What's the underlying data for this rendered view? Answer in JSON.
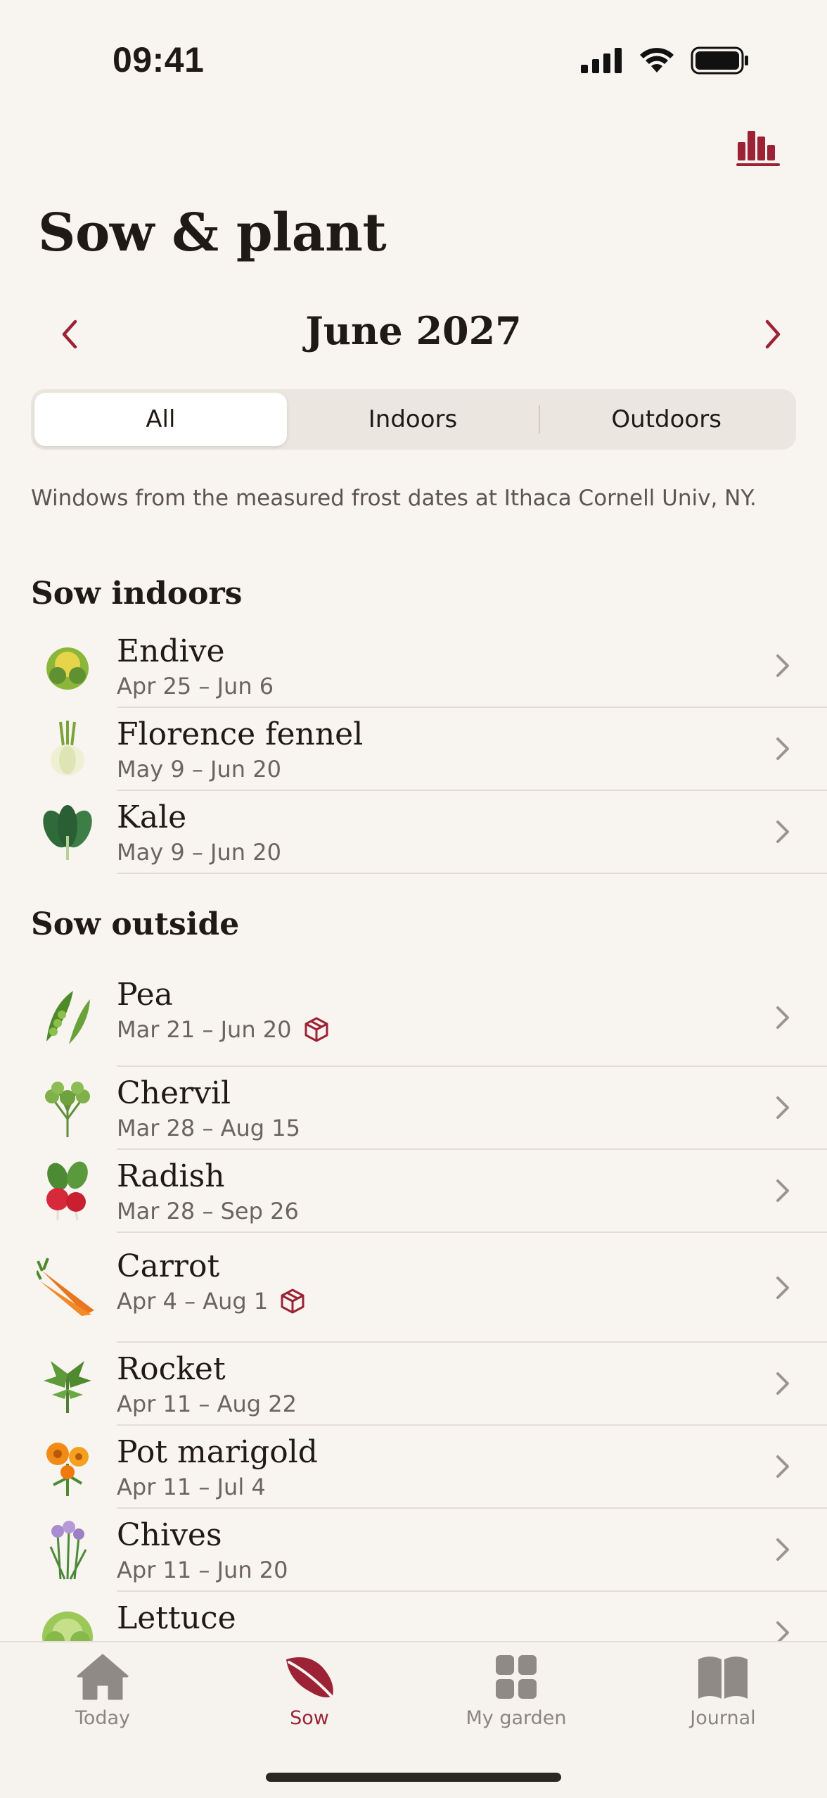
{
  "status_bar": {
    "time": "09:41"
  },
  "header": {
    "title": "Sow & plant",
    "stats_icon": "bar-chart-icon"
  },
  "month_nav": {
    "label": "June 2027",
    "prev_icon": "chevron-left-icon",
    "next_icon": "chevron-right-icon"
  },
  "filter": {
    "segments": [
      "All",
      "Indoors",
      "Outdoors"
    ],
    "selected": "All"
  },
  "frost_note": "Windows from the measured frost dates at Ithaca Cornell Univ, NY.",
  "sections": [
    {
      "title": "Sow indoors",
      "items": [
        {
          "name": "Endive",
          "dates": "Apr 25 – Jun 6",
          "icon": "endive-icon"
        },
        {
          "name": "Florence fennel",
          "dates": "May 9 – Jun 20",
          "icon": "fennel-icon"
        },
        {
          "name": "Kale",
          "dates": "May 9 – Jun 20",
          "icon": "kale-icon"
        }
      ]
    },
    {
      "title": "Sow outside",
      "items": [
        {
          "name": "Pea",
          "dates": "Mar 21 – Jun 20",
          "icon": "pea-icon",
          "badge": "package-icon"
        },
        {
          "name": "Chervil",
          "dates": "Mar 28 – Aug 15",
          "icon": "chervil-icon"
        },
        {
          "name": "Radish",
          "dates": "Mar 28 – Sep 26",
          "icon": "radish-icon"
        },
        {
          "name": "Carrot",
          "dates": "Apr 4 – Aug 1",
          "icon": "carrot-icon",
          "badge": "package-icon"
        },
        {
          "name": "Rocket",
          "dates": "Apr 11 – Aug 22",
          "icon": "rocket-icon"
        },
        {
          "name": "Pot marigold",
          "dates": "Apr 11 – Jul 4",
          "icon": "marigold-icon"
        },
        {
          "name": "Chives",
          "dates": "Apr 11 – Jun 20",
          "icon": "chives-icon"
        },
        {
          "name": "Lettuce",
          "icon": "lettuce-icon"
        }
      ]
    }
  ],
  "tab_bar": {
    "tabs": [
      {
        "label": "Today",
        "icon": "home-icon"
      },
      {
        "label": "Sow",
        "icon": "leaf-icon"
      },
      {
        "label": "My garden",
        "icon": "grid-icon"
      },
      {
        "label": "Journal",
        "icon": "book-icon"
      }
    ],
    "active": "Sow"
  },
  "colors": {
    "accent": "#9b2335",
    "background": "#f8f4ef",
    "muted": "#6b655f"
  }
}
